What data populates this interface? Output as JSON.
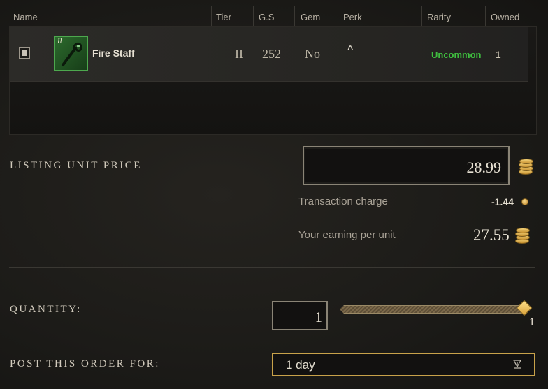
{
  "table": {
    "columns": [
      "Name",
      "Tier",
      "G.S",
      "Gem",
      "Perk",
      "Rarity",
      "Owned"
    ],
    "item": {
      "name": "Fire Staff",
      "icon_tier_mark": "II",
      "tier": "II",
      "gear_score": "252",
      "gem": "No",
      "perk": "^",
      "rarity": "Uncommon",
      "owned": "1",
      "rarity_color": "#3fbf3f"
    }
  },
  "listing": {
    "unit_price_label": "LISTING UNIT PRICE",
    "unit_price": "28.99",
    "transaction_charge_label": "Transaction charge",
    "transaction_charge": "-1.44",
    "earning_label": "Your earning per unit",
    "earning": "27.55"
  },
  "quantity": {
    "label": "QUANTITY:",
    "value": "1",
    "slider_max": "1",
    "slider_fraction": 1.0
  },
  "duration": {
    "label": "POST THIS ORDER FOR:",
    "selected": "1 day"
  },
  "colors": {
    "accent_gold": "#c8a24a",
    "rarity_uncommon": "#3fbf3f"
  }
}
